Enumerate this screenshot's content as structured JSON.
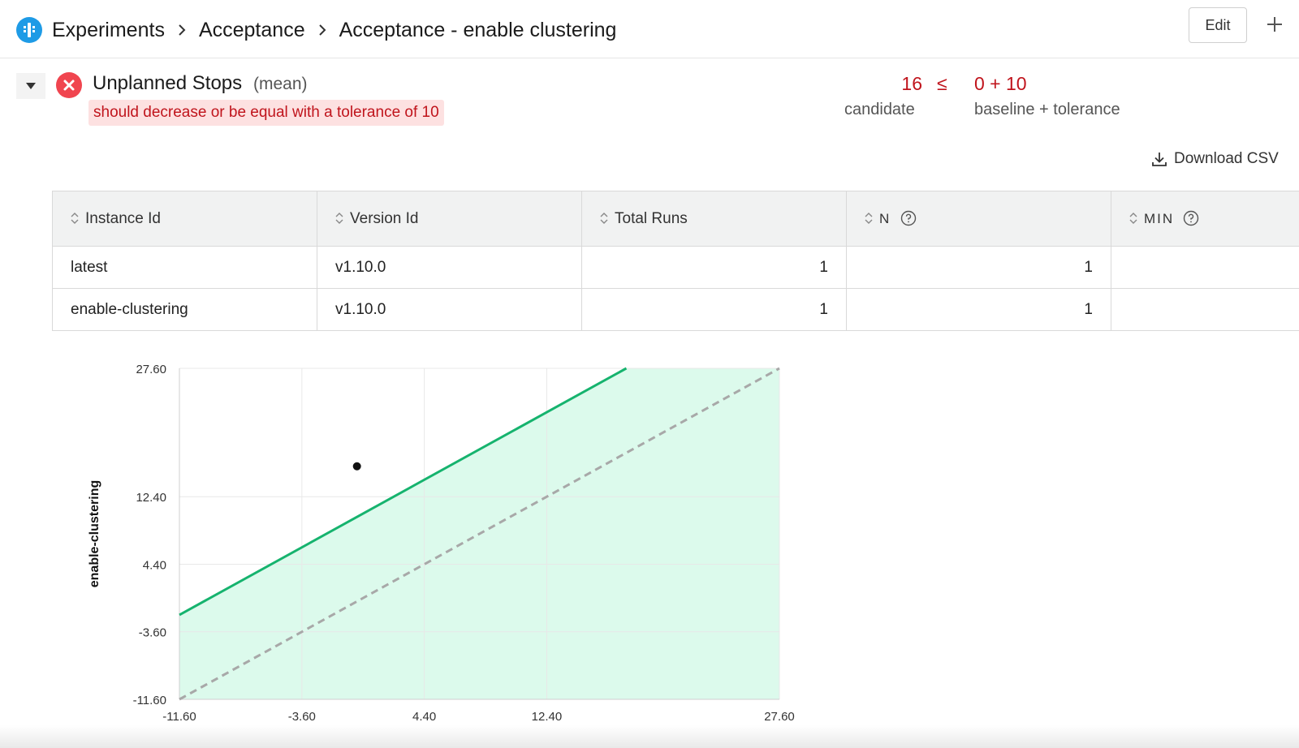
{
  "header": {
    "breadcrumbs": [
      "Experiments",
      "Acceptance",
      "Acceptance - enable clustering"
    ],
    "edit_label": "Edit",
    "logo_icon": "app-logo-icon",
    "add_icon": "plus-icon"
  },
  "metric": {
    "title": "Unplanned Stops",
    "aggregation": "(mean)",
    "criteria": "should decrease or be equal with a tolerance of 10",
    "status": "failed",
    "candidate_value": "16",
    "operator": "≤",
    "baseline_expression": "0 + 10",
    "candidate_label": "candidate",
    "baseline_label": "baseline + tolerance",
    "download_label": "Download CSV"
  },
  "colors": {
    "accent": "#1e9be6",
    "fail": "#f0454f",
    "fail_text": "#c0141c",
    "fail_bg": "#fde1e1",
    "pass_line": "#16b36e",
    "pass_area": "#dcfaec"
  },
  "table": {
    "columns": [
      {
        "label": "Instance Id"
      },
      {
        "label": "Version Id"
      },
      {
        "label": "Total Runs"
      },
      {
        "label": "N"
      },
      {
        "label": "MIN"
      }
    ],
    "rows": [
      {
        "instance": "latest",
        "version": "v1.10.0",
        "runs": "1",
        "n": "1",
        "min": ""
      },
      {
        "instance": "enable-clustering",
        "version": "v1.10.0",
        "runs": "1",
        "n": "1",
        "min": ""
      }
    ]
  },
  "chart_data": {
    "type": "scatter",
    "ylabel": "enable-clustering",
    "xlabel": "",
    "xlim": [
      -11.6,
      27.6
    ],
    "ylim": [
      -11.6,
      27.6
    ],
    "x_ticks": [
      "-11.60",
      "-3.60",
      "4.40",
      "12.40",
      "27.60"
    ],
    "y_ticks": [
      "-11.60",
      "-3.60",
      "4.40",
      "12.40",
      "27.60"
    ],
    "x_tick_values": [
      -11.6,
      -3.6,
      4.4,
      12.4,
      27.6
    ],
    "y_tick_values": [
      -11.6,
      -3.6,
      4.4,
      12.4,
      27.6
    ],
    "points": [
      {
        "x": 0,
        "y": 16
      }
    ],
    "tolerance": 10,
    "threshold_line": {
      "intercept": 10,
      "slope": 1
    },
    "equality_line": {
      "intercept": 0,
      "slope": 1
    },
    "grid": true
  }
}
